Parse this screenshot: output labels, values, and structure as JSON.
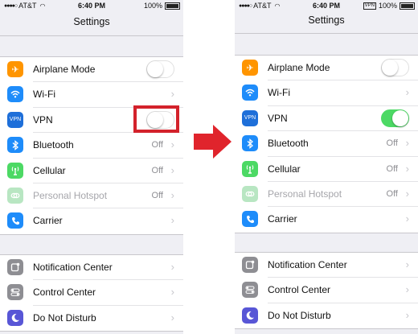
{
  "colors": {
    "airplane": "#ff9500",
    "wifi": "#1e8cfa",
    "vpn": "#1e6fd9",
    "bluetooth": "#1e8cfa",
    "cellular": "#4cd964",
    "hotspot_dim": "#b8e6c2",
    "carrier": "#1e8cfa",
    "settings_gray": "#8e8e93",
    "dnd": "#5856d6",
    "toggle_on": "#4cd964",
    "highlight": "#d3222b",
    "arrow": "#e0242c"
  },
  "transition_arrow_icon": "right-arrow-icon",
  "phones": [
    {
      "status": {
        "carrier": "AT&T",
        "time": "6:40 PM",
        "battery": "100%",
        "vpn_badge": ""
      },
      "title": "Settings",
      "vpn_toggle_on": false,
      "items": [
        {
          "label": "Airplane Mode",
          "icon": "airplane-icon"
        },
        {
          "label": "Wi-Fi",
          "icon": "wifi-icon"
        },
        {
          "label": "VPN",
          "icon": "vpn-icon"
        },
        {
          "label": "Bluetooth",
          "icon": "bluetooth-icon",
          "value": "Off"
        },
        {
          "label": "Cellular",
          "icon": "cellular-icon",
          "value": "Off"
        },
        {
          "label": "Personal Hotspot",
          "icon": "hotspot-icon",
          "value": "Off"
        },
        {
          "label": "Carrier",
          "icon": "phone-icon"
        },
        {
          "label": "Notification Center",
          "icon": "notification-center-icon"
        },
        {
          "label": "Control Center",
          "icon": "control-center-icon"
        },
        {
          "label": "Do Not Disturb",
          "icon": "moon-icon"
        }
      ]
    },
    {
      "status": {
        "carrier": "AT&T",
        "time": "6:40 PM",
        "battery": "100%",
        "vpn_badge": "VPN"
      },
      "title": "Settings",
      "vpn_toggle_on": true,
      "items": [
        {
          "label": "Airplane Mode",
          "icon": "airplane-icon"
        },
        {
          "label": "Wi-Fi",
          "icon": "wifi-icon"
        },
        {
          "label": "VPN",
          "icon": "vpn-icon"
        },
        {
          "label": "Bluetooth",
          "icon": "bluetooth-icon",
          "value": "Off"
        },
        {
          "label": "Cellular",
          "icon": "cellular-icon",
          "value": "Off"
        },
        {
          "label": "Personal Hotspot",
          "icon": "hotspot-icon",
          "value": "Off"
        },
        {
          "label": "Carrier",
          "icon": "phone-icon"
        },
        {
          "label": "Notification Center",
          "icon": "notification-center-icon"
        },
        {
          "label": "Control Center",
          "icon": "control-center-icon"
        },
        {
          "label": "Do Not Disturb",
          "icon": "moon-icon"
        }
      ]
    }
  ]
}
